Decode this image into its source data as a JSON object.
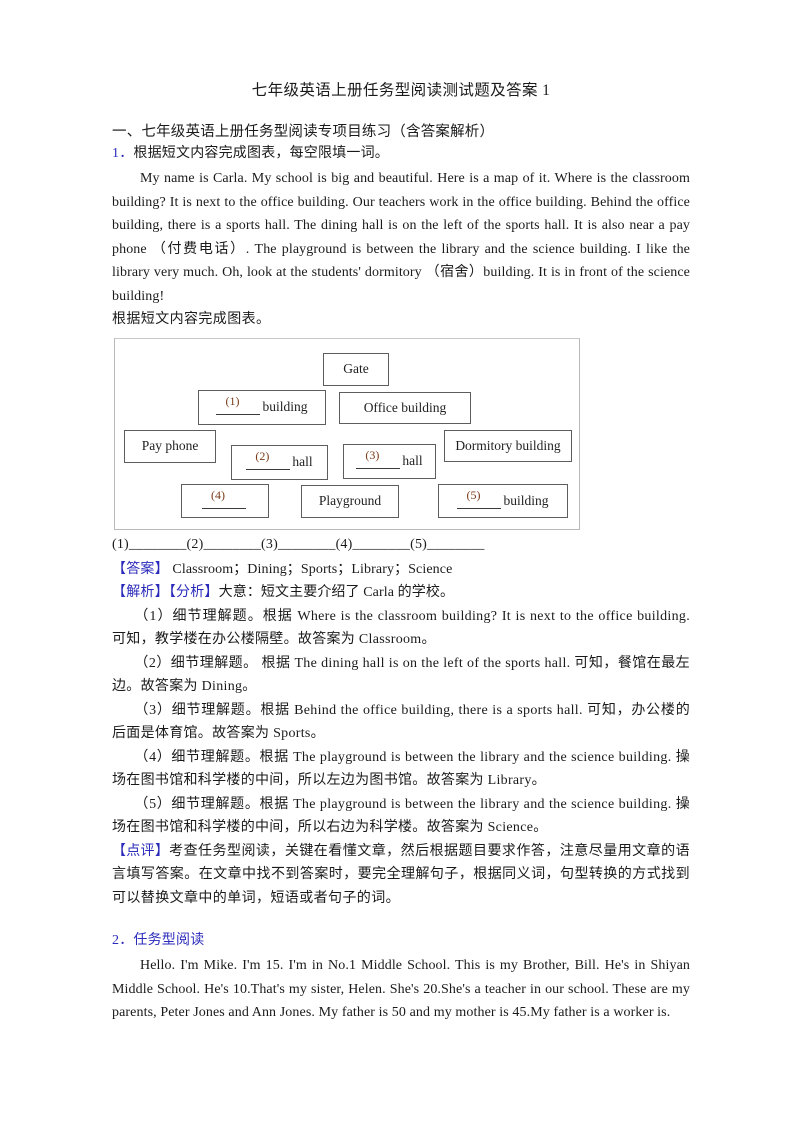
{
  "document": {
    "title": "七年级英语上册任务型阅读测试题及答案 1",
    "section_heading": "一、七年级英语上册任务型阅读专项目练习（含答案解析）"
  },
  "question1": {
    "number": "1．",
    "prompt": "根据短文内容完成图表，每空限填一词。",
    "passage": "My name is Carla. My school is big and beautiful. Here is a map of it. Where is the classroom building? It is next to the office building. Our teachers work in the office building. Behind the office building, there is a sports hall. The dining hall is on the left of the sports hall. It is also near a pay phone （付费电话）. The playground is between the library and the science building. I like the library very much. Oh, look at the students' dormitory （宿舍）building. It is in front of the science building!",
    "instruction": "根据短文内容完成图表。",
    "answer_line": "(1)________(2)________(3)________(4)________(5)________",
    "answer_tag": "【答案】",
    "answer_text": "Classroom；Dining；Sports；Library；Science",
    "analysis_tag": "【解析】",
    "analysis_sub_tag": "【分析】",
    "analysis_intro": "大意：短文主要介绍了 Carla 的学校。",
    "explanations": [
      "（1）细节理解题。根据 Where is the classroom building? It is next to the office building. 可知，教学楼在办公楼隔壁。故答案为 Classroom。",
      "（2）细节理解题。 根据 The dining hall is on the left of the sports hall. 可知，餐馆在最左边。故答案为 Dining。",
      "（3）细节理解题。根据 Behind the office building, there is a sports hall. 可知，办公楼的后面是体育馆。故答案为 Sports。",
      "（4）细节理解题。根据 The playground is between the library and the science building. 操场在图书馆和科学楼的中间，所以左边为图书馆。故答案为 Library。",
      "（5）细节理解题。根据 The playground is between the library and the science building. 操场在图书馆和科学楼的中间，所以右边为科学楼。故答案为 Science。"
    ],
    "comment_tag": "【点评】",
    "comment_text": "考查任务型阅读，关键在看懂文章，然后根据题目要求作答，注意尽量用文章的语言填写答案。在文章中找不到答案时，要完全理解句子，根据同义词，句型转换的方式找到可以替换文章中的单词，短语或者句子的词。"
  },
  "diagram": {
    "boxes": [
      {
        "id": "gate",
        "label": "Gate",
        "blank": "",
        "suffix": ""
      },
      {
        "id": "classroom-building",
        "label": "",
        "blank": "(1)",
        "suffix": "building"
      },
      {
        "id": "office-building",
        "label": "Office building",
        "blank": "",
        "suffix": ""
      },
      {
        "id": "pay-phone",
        "label": "Pay phone",
        "blank": "",
        "suffix": ""
      },
      {
        "id": "dining-hall",
        "label": "",
        "blank": "(2)",
        "suffix": "hall"
      },
      {
        "id": "sports-hall",
        "label": "",
        "blank": "(3)",
        "suffix": "hall"
      },
      {
        "id": "dormitory-building",
        "label": "Dormitory building",
        "blank": "",
        "suffix": ""
      },
      {
        "id": "library",
        "label": "",
        "blank": "(4)",
        "suffix": ""
      },
      {
        "id": "playground",
        "label": "Playground",
        "blank": "",
        "suffix": ""
      },
      {
        "id": "science-building",
        "label": "",
        "blank": "(5)",
        "suffix": "building"
      }
    ]
  },
  "question2": {
    "number": "2．",
    "prompt": "任务型阅读",
    "passage": "Hello. I'm Mike. I'm 15. I'm in No.1 Middle School. This is my Brother, Bill. He's in Shiyan Middle School. He's 10.That's my sister, Helen. She's 20.She's a teacher in our school. These are my parents, Peter Jones and Ann Jones. My father is 50 and my mother is 45.My father is a worker is."
  },
  "colors": {
    "blue_marker": "#2b2bbb",
    "blank_number": "#7a3b18",
    "text": "#1a1a1a",
    "diagram_border": "#b9b9b9",
    "box_border": "#5d5d5d"
  }
}
